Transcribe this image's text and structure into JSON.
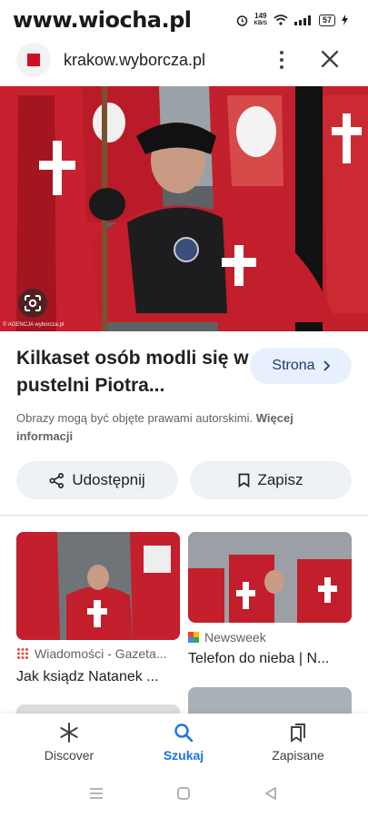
{
  "status_bar": {
    "watermark": "www.wiocha.pl",
    "net_speed": "149",
    "net_unit": "KB/S",
    "battery": "57"
  },
  "header": {
    "url": "krakow.wyborcza.pl",
    "menu_icon": "more-vert-icon",
    "close_icon": "close-icon"
  },
  "hero": {
    "credit": "© AGENCJA wyborcza.pl",
    "lens_icon": "google-lens-icon"
  },
  "result": {
    "title": "Kilkaset osób modli się w pustelni Piotra...",
    "visit_label": "Strona",
    "copyright_text": "Obrazy mogą być objęte prawami autorskimi.",
    "more_info_label": "Więcej informacji",
    "share_label": "Udostępnij",
    "save_label": "Zapisz"
  },
  "related": [
    {
      "source": "Wiadomości - Gazeta...",
      "title": "Jak ksiądz Natanek ..."
    },
    {
      "source": "Newsweek",
      "title": "Telefon do nieba | N..."
    }
  ],
  "bottom_nav": [
    {
      "label": "Discover",
      "icon": "asterisk-icon"
    },
    {
      "label": "Szukaj",
      "icon": "search-icon"
    },
    {
      "label": "Zapisane",
      "icon": "bookmarks-icon"
    }
  ],
  "colors": {
    "accent": "#1a73e8",
    "chip_bg": "#e8f0fe",
    "button_bg": "#eef1f5",
    "brand_red": "#d10f24"
  }
}
